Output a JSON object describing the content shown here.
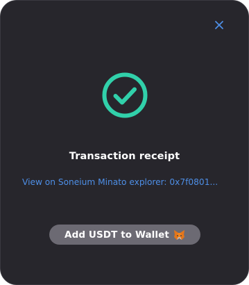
{
  "modal": {
    "close_icon": "close-icon",
    "status_icon": "check-circle-icon",
    "title": "Transaction receipt",
    "explorer_link": "View on Soneium Minato explorer: 0x7f0801...",
    "add_token_button": {
      "label": "Add USDT to Wallet",
      "icon": "metamask-fox-icon"
    }
  },
  "colors": {
    "background": "#27262c",
    "success": "#31d0aa",
    "link": "#4e8fe7",
    "close": "#4e8fe7",
    "button_bg": "#6c6a73",
    "text": "#ffffff"
  }
}
